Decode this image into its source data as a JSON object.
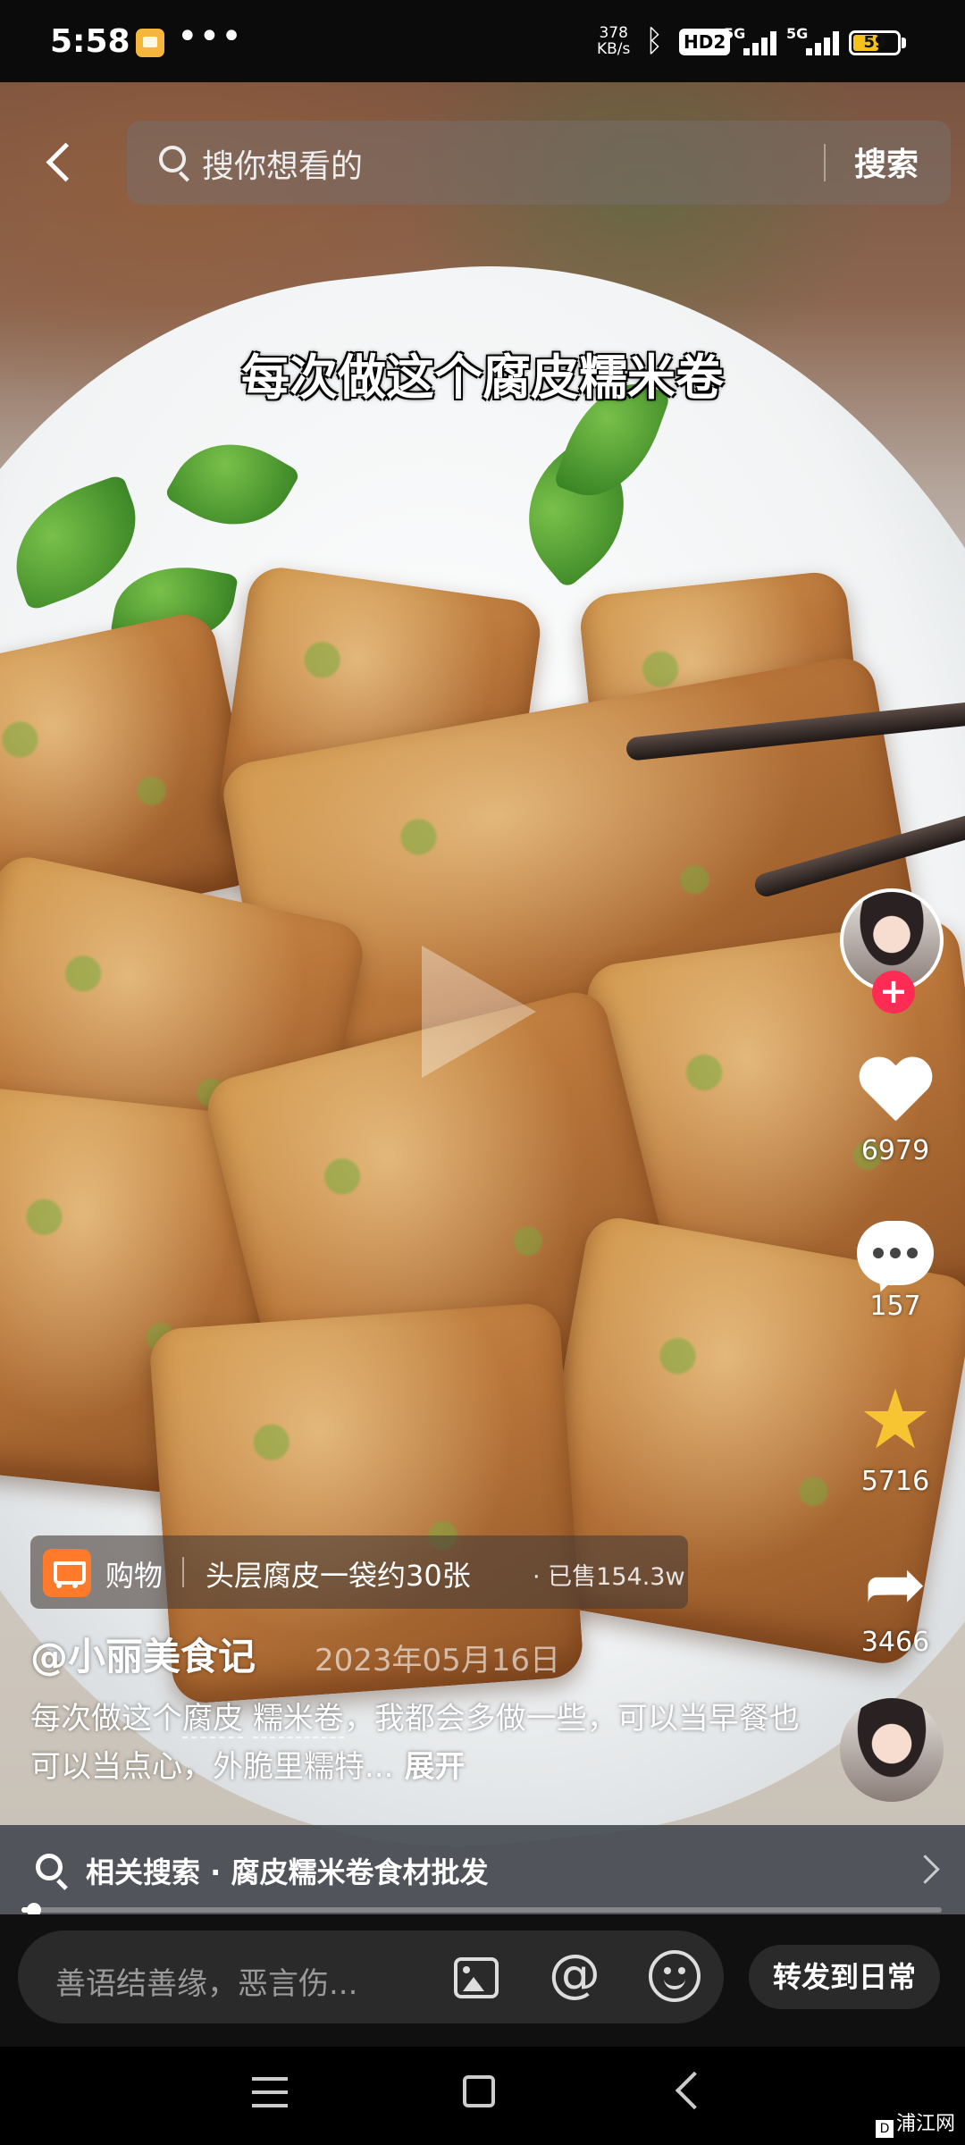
{
  "status_bar": {
    "time": "5:58",
    "dots": "•••",
    "network_speed_value": "378",
    "network_speed_unit": "KB/s",
    "hd_label": "HD2",
    "signal_1_label": "5G",
    "signal_2_label": "5G",
    "battery_level": "59",
    "battery_fill_fraction": 0.59,
    "battery_color": "#f4c21b"
  },
  "top_bar": {
    "search_placeholder": "搜你想看的",
    "search_button": "搜索"
  },
  "video": {
    "caption": "每次做这个腐皮糯米卷"
  },
  "right_rail": {
    "like_count": "6979",
    "comment_count": "157",
    "favorite_count": "5716",
    "share_count": "3466",
    "follow_symbol": "+",
    "favorite_color": "#f7c531",
    "follow_color": "#fe2c55"
  },
  "product": {
    "tag": "购物",
    "title": "头层腐皮一袋约30张",
    "sold": "· 已售154.3w",
    "icon_color": "#ff7a2a"
  },
  "post": {
    "author": "@小丽美食记",
    "date": "2023年05月16日",
    "desc_prefix": "每次做这个",
    "desc_tag1": "腐皮",
    "desc_space": " ",
    "desc_tag2": "糯米卷",
    "desc_rest": "，我都会多做一些，可以当早餐也可以当点心，外脆里糯特...",
    "expand": "展开"
  },
  "related_search": {
    "text": "相关搜索 · 腐皮糯米卷食材批发"
  },
  "playback": {
    "progress_fraction": 0.01
  },
  "comment_bar": {
    "placeholder": "善语结善缘，恶言伤...",
    "mention_symbol": "@",
    "forward_button": "转发到日常"
  },
  "watermark": {
    "mark": "D",
    "text": "浦江网"
  }
}
